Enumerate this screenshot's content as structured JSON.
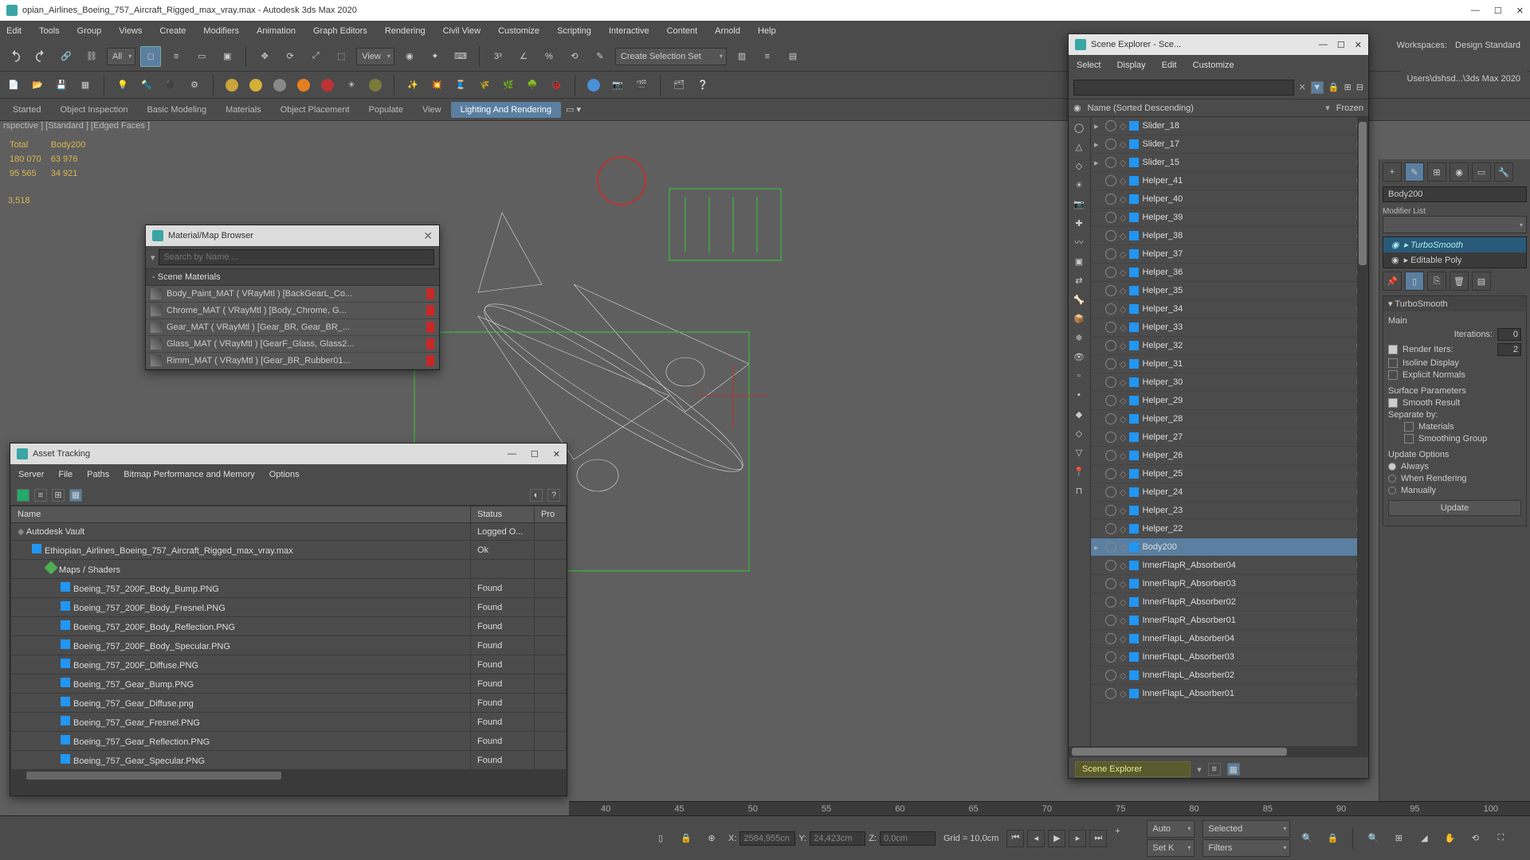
{
  "title": "opian_Airlines_Boeing_757_Aircraft_Rigged_max_vray.max - Autodesk 3ds Max 2020",
  "mainmenu": [
    "Edit",
    "Tools",
    "Group",
    "Views",
    "Create",
    "Modifiers",
    "Animation",
    "Graph Editors",
    "Rendering",
    "Civil View",
    "Customize",
    "Scripting",
    "Interactive",
    "Content",
    "Arnold",
    "Help"
  ],
  "toolbar1": {
    "filter": "All",
    "view": "View",
    "selset": "Create Selection Set"
  },
  "ribbon": {
    "tabs": [
      "Started",
      "Object Inspection",
      "Basic Modeling",
      "Materials",
      "Object Placement",
      "Populate",
      "View",
      "Lighting And Rendering"
    ],
    "active": 7
  },
  "vp_label": "rspective ] [Standard ] [Edged Faces ]",
  "stats": {
    "h1": "Total",
    "h2": "Body200",
    "r1a": "180 070",
    "r1b": "63 976",
    "r2a": "95 565",
    "r2b": "34 921",
    "extra": "3,518"
  },
  "matbrowser": {
    "title": "Material/Map Browser",
    "search_ph": "Search by Name ...",
    "section": "Scene Materials",
    "items": [
      "Body_Paint_MAT  ( VRayMtl )  [BackGearL_Co...",
      "Chrome_MAT  ( VRayMtl )  [Body_Chrome, G...",
      "Gear_MAT  ( VRayMtl )  [Gear_BR, Gear_BR_...",
      "Glass_MAT  ( VRayMtl )  [GearF_Glass, Glass2...",
      "Rimm_MAT  ( VRayMtl )  [Gear_BR_Rubber01..."
    ]
  },
  "assettrack": {
    "title": "Asset Tracking",
    "menu": [
      "Server",
      "File",
      "Paths",
      "Bitmap Performance and Memory",
      "Options"
    ],
    "cols": [
      "Name",
      "Status",
      "Pro"
    ],
    "rows": [
      {
        "name": "Autodesk Vault",
        "status": "Logged O...",
        "kind": "vault",
        "indent": 0
      },
      {
        "name": "Ethiopian_Airlines_Boeing_757_Aircraft_Rigged_max_vray.max",
        "status": "Ok",
        "kind": "max",
        "indent": 1
      },
      {
        "name": "Maps / Shaders",
        "status": "",
        "kind": "grp",
        "indent": 2
      },
      {
        "name": "Boeing_757_200F_Body_Bump.PNG",
        "status": "Found",
        "kind": "map",
        "indent": 3
      },
      {
        "name": "Boeing_757_200F_Body_Fresnel.PNG",
        "status": "Found",
        "kind": "map",
        "indent": 3
      },
      {
        "name": "Boeing_757_200F_Body_Reflection.PNG",
        "status": "Found",
        "kind": "map",
        "indent": 3
      },
      {
        "name": "Boeing_757_200F_Body_Specular.PNG",
        "status": "Found",
        "kind": "map",
        "indent": 3
      },
      {
        "name": "Boeing_757_200F_Diffuse.PNG",
        "status": "Found",
        "kind": "map",
        "indent": 3
      },
      {
        "name": "Boeing_757_Gear_Bump.PNG",
        "status": "Found",
        "kind": "map",
        "indent": 3
      },
      {
        "name": "Boeing_757_Gear_Diffuse.png",
        "status": "Found",
        "kind": "map",
        "indent": 3
      },
      {
        "name": "Boeing_757_Gear_Fresnel.PNG",
        "status": "Found",
        "kind": "map",
        "indent": 3
      },
      {
        "name": "Boeing_757_Gear_Reflection.PNG",
        "status": "Found",
        "kind": "map",
        "indent": 3
      },
      {
        "name": "Boeing_757_Gear_Specular.PNG",
        "status": "Found",
        "kind": "map",
        "indent": 3
      }
    ]
  },
  "sceneexp": {
    "title": "Scene Explorer - Sce...",
    "menu": [
      "Select",
      "Display",
      "Edit",
      "Customize"
    ],
    "colname": "Name (Sorted Descending)",
    "colfrozen": "Frozen",
    "rows": [
      {
        "t": "Slider_18",
        "arrow": true,
        "sel": false
      },
      {
        "t": "Slider_17",
        "arrow": true,
        "sel": false
      },
      {
        "t": "Slider_15",
        "arrow": true,
        "sel": false
      },
      {
        "t": "Helper_41",
        "sel": false
      },
      {
        "t": "Helper_40",
        "sel": false
      },
      {
        "t": "Helper_39",
        "sel": false
      },
      {
        "t": "Helper_38",
        "sel": false
      },
      {
        "t": "Helper_37",
        "sel": false
      },
      {
        "t": "Helper_36",
        "sel": false
      },
      {
        "t": "Helper_35",
        "sel": false
      },
      {
        "t": "Helper_34",
        "sel": false
      },
      {
        "t": "Helper_33",
        "sel": false
      },
      {
        "t": "Helper_32",
        "sel": false
      },
      {
        "t": "Helper_31",
        "sel": false
      },
      {
        "t": "Helper_30",
        "sel": false
      },
      {
        "t": "Helper_29",
        "sel": false
      },
      {
        "t": "Helper_28",
        "sel": false
      },
      {
        "t": "Helper_27",
        "sel": false
      },
      {
        "t": "Helper_26",
        "sel": false
      },
      {
        "t": "Helper_25",
        "sel": false
      },
      {
        "t": "Helper_24",
        "sel": false
      },
      {
        "t": "Helper_23",
        "sel": false
      },
      {
        "t": "Helper_22",
        "sel": false
      },
      {
        "t": "Body200",
        "arrow": true,
        "sel": true
      },
      {
        "t": "InnerFlapR_Absorber04",
        "sel": false
      },
      {
        "t": "InnerFlapR_Absorber03",
        "sel": false
      },
      {
        "t": "InnerFlapR_Absorber02",
        "sel": false
      },
      {
        "t": "InnerFlapR_Absorber01",
        "sel": false
      },
      {
        "t": "InnerFlapL_Absorber04",
        "sel": false
      },
      {
        "t": "InnerFlapL_Absorber03",
        "sel": false
      },
      {
        "t": "InnerFlapL_Absorber02",
        "sel": false
      },
      {
        "t": "InnerFlapL_Absorber01",
        "sel": false
      }
    ],
    "footer": "Scene Explorer"
  },
  "toprt": {
    "workspaces": "Workspaces:",
    "ws": "Design Standard",
    "path": "Users\\dshsd...\\3ds Max 2020"
  },
  "cmdpanel": {
    "objname": "Body200",
    "modlist_label": "Modifier List",
    "mods": [
      {
        "n": "TurboSmooth",
        "sel": true
      },
      {
        "n": "Editable Poly",
        "sel": false
      }
    ],
    "rollout_title": "TurboSmooth",
    "main": "Main",
    "iter_lbl": "Iterations:",
    "iter": "0",
    "rend_lbl": "Render Iters:",
    "rend": "2",
    "iso": "Isoline Display",
    "expn": "Explicit Normals",
    "surface": "Surface Parameters",
    "smooth": "Smooth Result",
    "sep": "Separate by:",
    "sep1": "Materials",
    "sep2": "Smoothing Group",
    "upd": "Update Options",
    "u1": "Always",
    "u2": "When Rendering",
    "u3": "Manually",
    "updatebtn": "Update"
  },
  "timeline": [
    "40",
    "45",
    "50",
    "55",
    "60",
    "65",
    "70",
    "75",
    "80",
    "85",
    "90",
    "95",
    "100"
  ],
  "status": {
    "X": "X:",
    "xv": "2584,955cn",
    "Y": "Y:",
    "yv": "24,423cm",
    "Z": "Z:",
    "zv": "0,0cm",
    "grid": "Grid = 10,0cm",
    "auto": "Auto",
    "selected": "Selected",
    "setk": "Set K",
    "filters": "Filters"
  }
}
